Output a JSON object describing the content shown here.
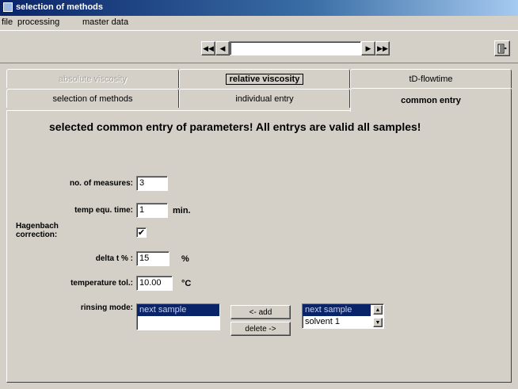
{
  "window": {
    "title": "selection of methods"
  },
  "menu": [
    {
      "label": "file"
    },
    {
      "label": "processing"
    },
    {
      "label": "master data"
    }
  ],
  "toolbar": {
    "nav_first": "◀◀",
    "nav_prev": "◀",
    "nav_next": "▶",
    "nav_last": "▶▶",
    "record_value": ""
  },
  "tabs_top": [
    {
      "label": "absolute viscosity",
      "state": "disabled"
    },
    {
      "label": "relative viscosity",
      "state": "boxed"
    },
    {
      "label": "tD-flowtime",
      "state": "normal"
    }
  ],
  "tabs_bottom": [
    {
      "label": "selection of methods"
    },
    {
      "label": "individual entry"
    },
    {
      "label": "common entry",
      "active": true
    }
  ],
  "content": {
    "heading": "selected common entry of parameters! All entrys are valid all samples!",
    "no_of_measures": {
      "label": "no. of measures:",
      "value": "3"
    },
    "temp_equ_time": {
      "label": "temp equ. time:",
      "value": "1",
      "unit": "min."
    },
    "hagenbach": {
      "label_line1": "Hagenbach",
      "label_line2": "correction:",
      "checked": true,
      "mark": "✔"
    },
    "delta_t": {
      "label": "delta t % :",
      "value": "15",
      "unit": "%"
    },
    "temperature_tol": {
      "label": "temperature tol.:",
      "value": "10.00",
      "unit": "°C"
    },
    "rinsing_mode": {
      "label": "rinsing mode:",
      "selected_list": [
        "next sample",
        ""
      ],
      "add_label": "<- add",
      "delete_label": "delete ->",
      "available_list": [
        "next sample",
        "solvent 1"
      ]
    }
  }
}
